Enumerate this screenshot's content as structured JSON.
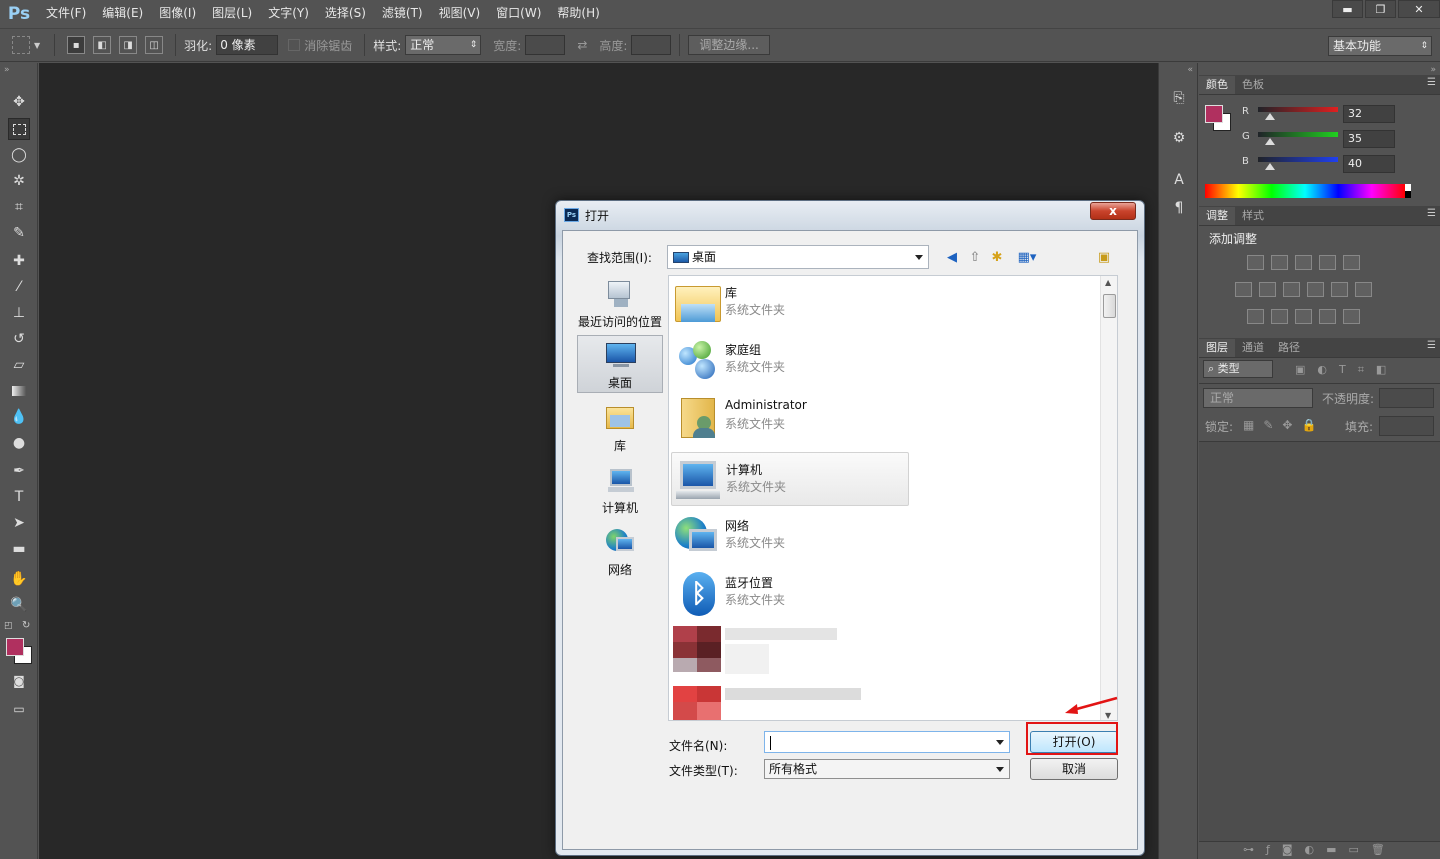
{
  "app": {
    "logo": "Ps",
    "menu": [
      "文件(F)",
      "编辑(E)",
      "图像(I)",
      "图层(L)",
      "文字(Y)",
      "选择(S)",
      "滤镜(T)",
      "视图(V)",
      "窗口(W)",
      "帮助(H)"
    ],
    "window_controls": [
      "▬",
      "❐",
      "✕"
    ]
  },
  "options": {
    "feather_label": "羽化:",
    "feather_value": "0 像素",
    "antialias_label": "消除锯齿",
    "style_label": "样式:",
    "style_value": "正常",
    "width_label": "宽度:",
    "height_label": "高度:",
    "refine_edge": "调整边缘...",
    "workspace": "基本功能"
  },
  "panels": {
    "color_tabs": [
      "颜色",
      "色板"
    ],
    "rgb": [
      {
        "label": "R",
        "value": "32"
      },
      {
        "label": "G",
        "value": "35"
      },
      {
        "label": "B",
        "value": "40"
      }
    ],
    "adjust_tabs": [
      "调整",
      "样式"
    ],
    "add_adjust": "添加调整",
    "layer_tabs": [
      "图层",
      "通道",
      "路径"
    ],
    "kind_filter": "⌕ 类型",
    "blend_mode": "正常",
    "opacity_label": "不透明度:",
    "lock_label": "锁定:",
    "fill_label": "填充:"
  },
  "dialog": {
    "title": "打开",
    "close": "x",
    "look_in_label": "查找范围(I):",
    "look_in_value": "桌面",
    "places": [
      "最近访问的位置",
      "桌面",
      "库",
      "计算机",
      "网络"
    ],
    "files": [
      {
        "name": "库",
        "type": "系统文件夹"
      },
      {
        "name": "家庭组",
        "type": "系统文件夹"
      },
      {
        "name": "Administrator",
        "type": "系统文件夹"
      },
      {
        "name": "计算机",
        "type": "系统文件夹"
      },
      {
        "name": "网络",
        "type": "系统文件夹"
      },
      {
        "name": "蓝牙位置",
        "type": "系统文件夹"
      }
    ],
    "file_name_label": "文件名(N):",
    "file_name_value": "",
    "file_type_label": "文件类型(T):",
    "file_type_value": "所有格式",
    "open_button": "打开(O)",
    "cancel_button": "取消"
  },
  "colors": {
    "foreground": "#b0305f",
    "background": "#ffffff",
    "highlight": "#e21414"
  }
}
